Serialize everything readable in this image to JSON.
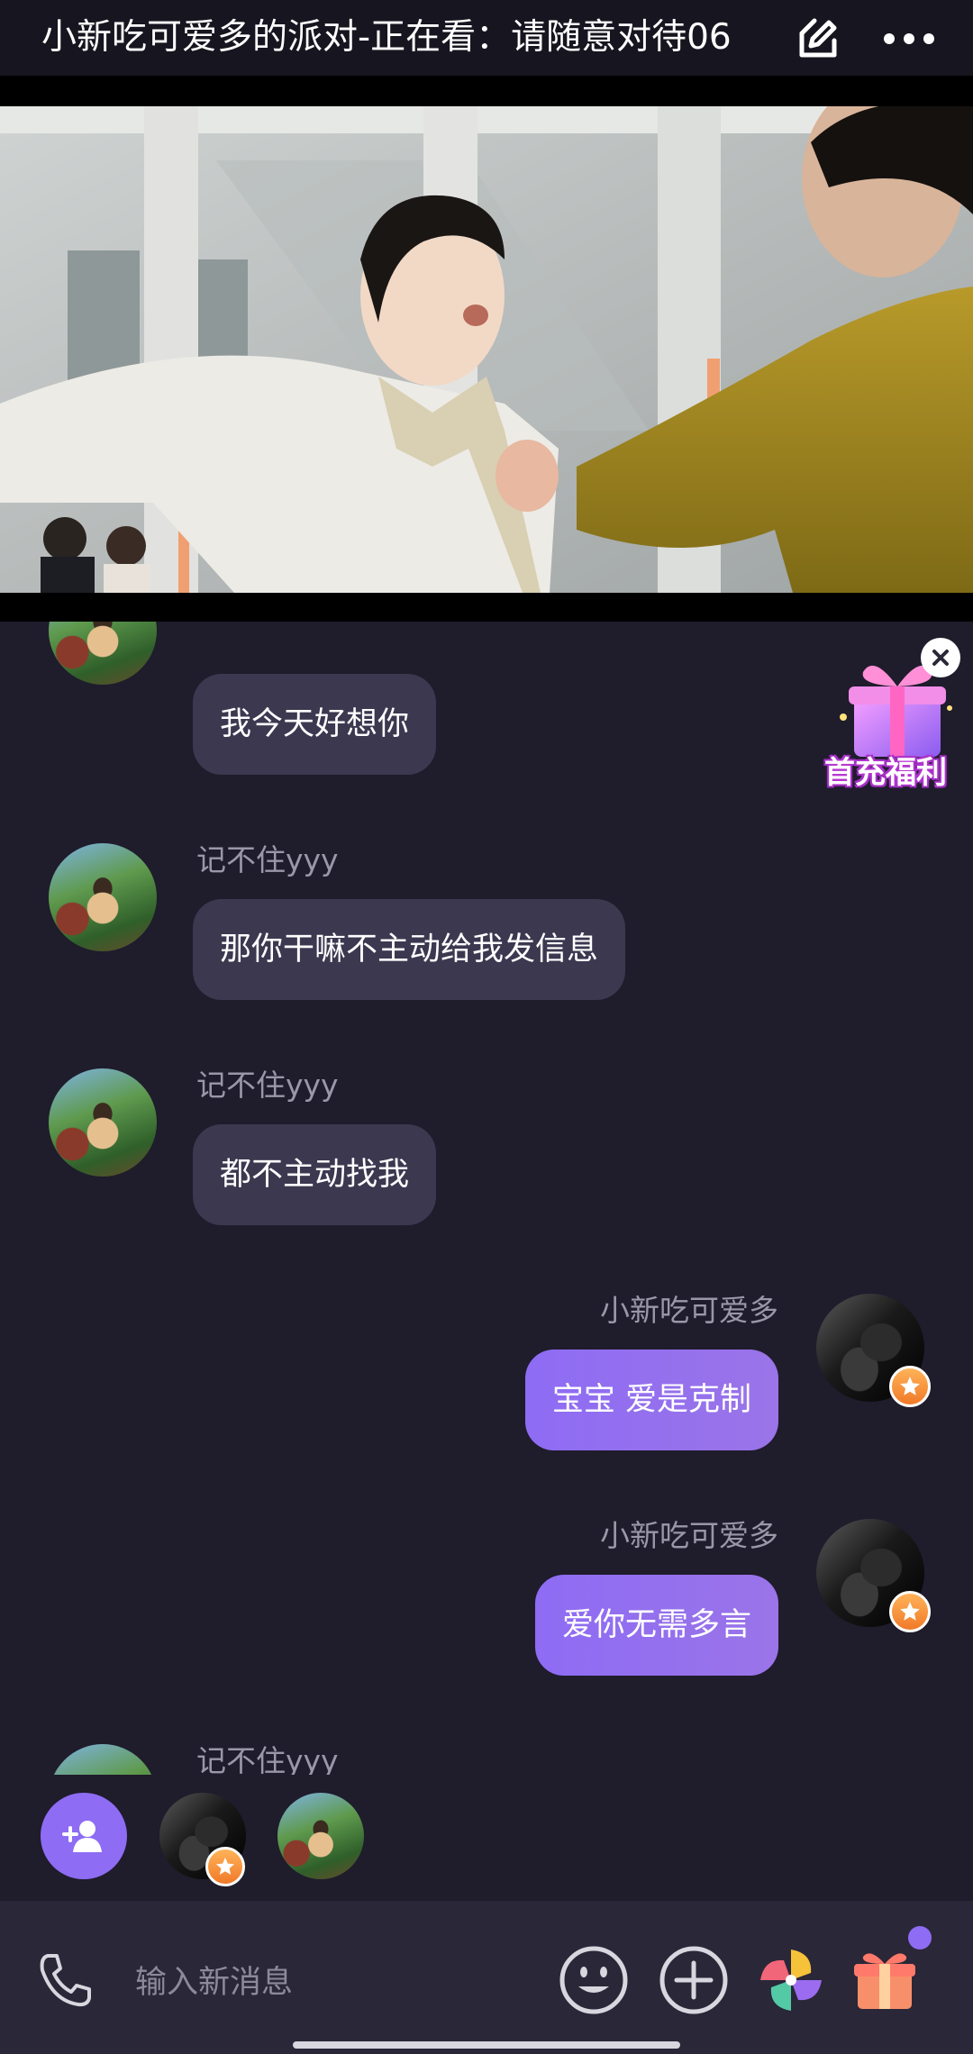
{
  "header": {
    "title": "小新吃可爱多的派对-正在看：请随意对待06",
    "edit_icon": "edit-icon",
    "more_icon": "more-icon"
  },
  "promo": {
    "label": "首充福利",
    "close_icon": "close-icon",
    "gift_icon": "gift-box-icon"
  },
  "messages": [
    {
      "side": "left",
      "sender": "",
      "text": "我今天好想你"
    },
    {
      "side": "left",
      "sender": "记不住yyy",
      "text": "那你干嘛不主动给我发信息"
    },
    {
      "side": "left",
      "sender": "记不住yyy",
      "text": "都不主动找我"
    },
    {
      "side": "right",
      "sender": "小新吃可爱多",
      "text": "宝宝 爱是克制"
    },
    {
      "side": "right",
      "sender": "小新吃可爱多",
      "text": "爱你无需多言"
    },
    {
      "side": "left",
      "sender": "记不住yyy",
      "text": ""
    }
  ],
  "input": {
    "placeholder": "输入新消息"
  },
  "colors": {
    "background": "#1f1c2c",
    "bubble_in": "#3b3850",
    "bubble_out": "#8e6cf4",
    "accent": "#8e6cf4"
  }
}
